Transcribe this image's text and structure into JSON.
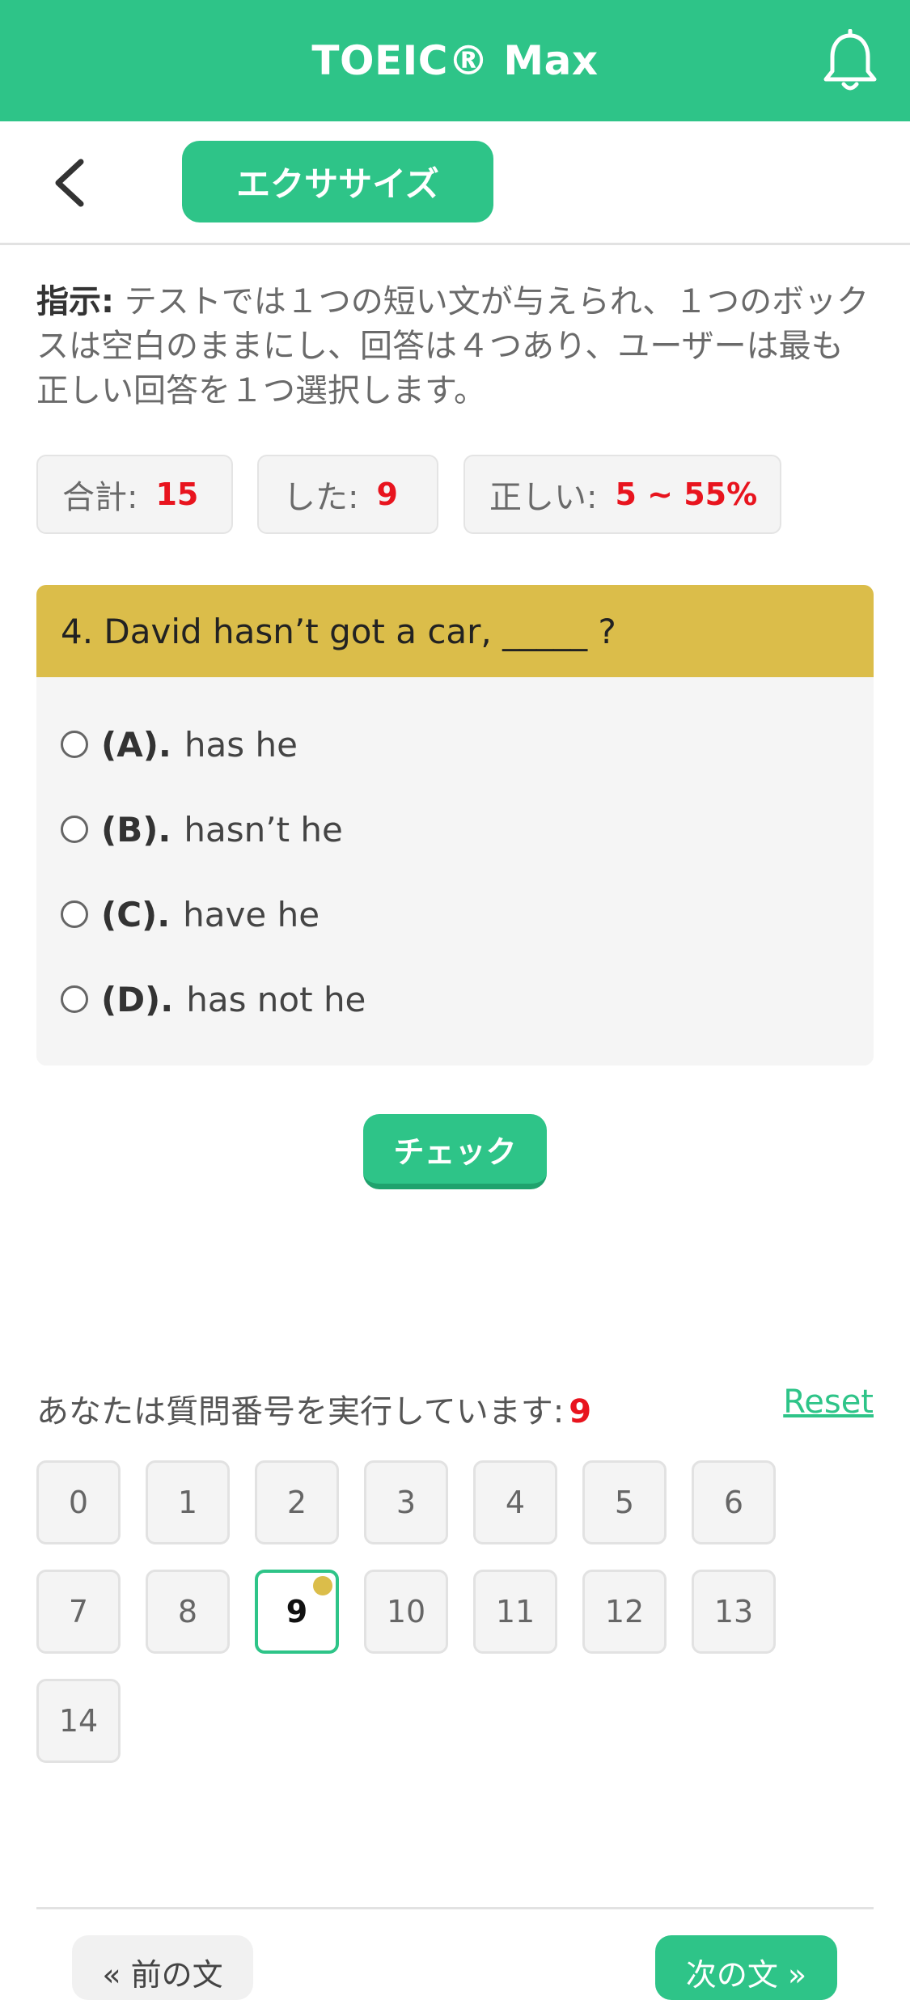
{
  "header": {
    "title": "TOEIC® Max",
    "bell_icon": "bell-icon"
  },
  "subbar": {
    "back_icon": "chevron-left-icon",
    "tab_label": "エクササイズ"
  },
  "instructions": {
    "label": "指示:",
    "text": " テストでは１つの短い文が与えられ、１つのボックスは空白のままにし、回答は４つあり、ユーザーは最も正しい回答を１つ選択します。"
  },
  "stats": {
    "total_label": "合計:",
    "total_value": "15",
    "done_label": "した:",
    "done_value": "9",
    "correct_label": "正しい:",
    "correct_value": "5 ~ 55%"
  },
  "question": {
    "text": "4. David hasn’t got a car, _____ ?",
    "options": [
      {
        "label": "(A).",
        "text": "has he"
      },
      {
        "label": "(B).",
        "text": "hasn’t he"
      },
      {
        "label": "(C).",
        "text": "have he"
      },
      {
        "label": "(D).",
        "text": "has not he"
      }
    ]
  },
  "check_label": "チェック",
  "progress": {
    "text": "あなたは質問番号を実行しています:",
    "current": "9",
    "reset_label": "Reset"
  },
  "numbers": [
    "0",
    "1",
    "2",
    "3",
    "4",
    "5",
    "6",
    "7",
    "8",
    "9",
    "10",
    "11",
    "12",
    "13",
    "14"
  ],
  "active_number": "9",
  "footer": {
    "prev_label": "« 前の文",
    "next_label": "次の文 »"
  },
  "colors": {
    "primary": "#2ec488",
    "question_header": "#dbbd4a",
    "highlight": "#e8141e"
  }
}
